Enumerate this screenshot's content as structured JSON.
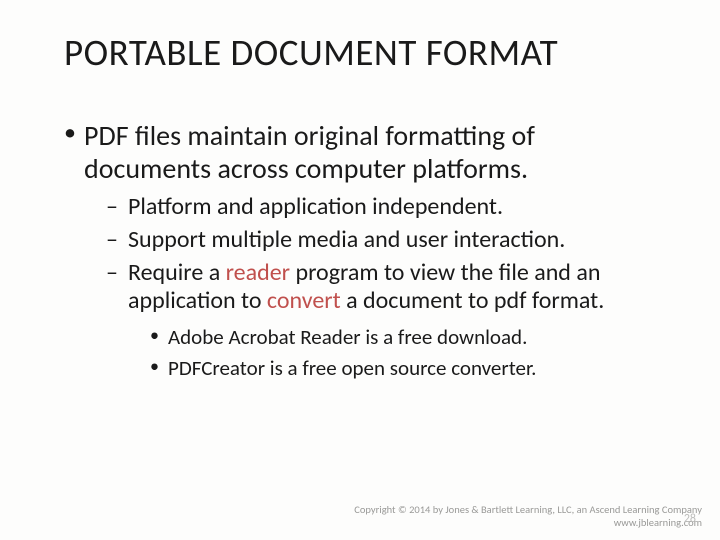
{
  "title": "PORTABLE DOCUMENT FORMAT",
  "bullets": {
    "main": "PDF files maintain original formatting of documents across computer platforms.",
    "subs": [
      "Platform and application independent.",
      "Support multiple media and user interaction.",
      {
        "pre": "Require a ",
        "hl1": "reader",
        "mid": " program to view the file and an application to ",
        "hl2": "convert",
        "post": " a document to pdf format."
      }
    ],
    "subsubs": [
      "Adobe Acrobat Reader is a free download.",
      "PDFCreator is a free open source converter."
    ]
  },
  "footer": {
    "line1": "Copyright © 2014 by Jones & Bartlett Learning, LLC, an Ascend Learning Company",
    "line2": "www.jblearning.com"
  },
  "page_number": "28"
}
